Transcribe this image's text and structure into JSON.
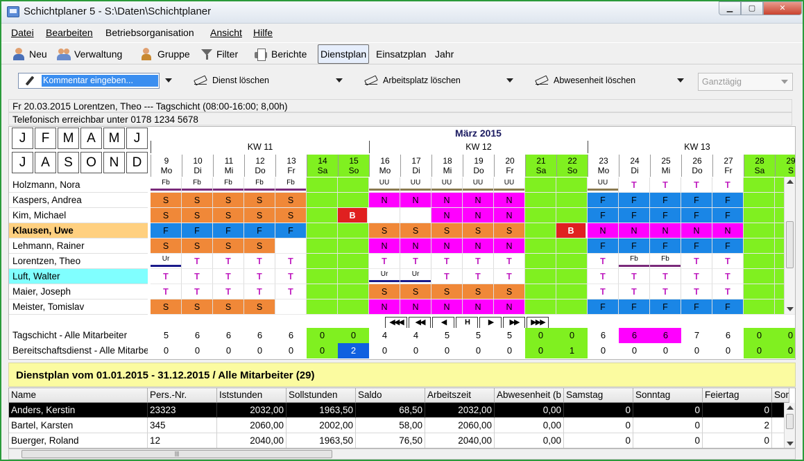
{
  "window": {
    "title": "Schichtplaner 5 - S:\\Daten\\Schichtplaner"
  },
  "menu": [
    "Datei",
    "Bearbeiten",
    "Betriebsorganisation",
    "Ansicht",
    "Hilfe"
  ],
  "toolbar": {
    "neu": "Neu",
    "verwaltung": "Verwaltung",
    "gruppe": "Gruppe",
    "filter": "Filter",
    "berichte": "Berichte",
    "dienstplan": "Dienstplan",
    "einsatzplan": "Einsatzplan",
    "jahr": "Jahr"
  },
  "actions": {
    "comment": "Kommentar eingeben...",
    "dienst": "Dienst löschen",
    "arbeitsplatz": "Arbeitsplatz löschen",
    "abwesenheit": "Abwesenheit löschen",
    "ganztaegig": "Ganztägig"
  },
  "info": {
    "line1": "Fr 20.03.2015 Lorentzen, Theo --- Tagschicht (08:00-16:00; 8,00h)",
    "line2": "Telefonisch erreichbar unter 0178 1234 5678"
  },
  "months": [
    [
      "J",
      "F",
      "M",
      "A",
      "M",
      "J"
    ],
    [
      "J",
      "A",
      "S",
      "O",
      "N",
      "D"
    ]
  ],
  "calendar": {
    "month": "März 2015",
    "weeks": [
      {
        "label": "KW 11"
      },
      {
        "label": "KW 12"
      },
      {
        "label": "KW 13"
      }
    ],
    "days": [
      {
        "d": "9",
        "w": "Mo",
        "we": false
      },
      {
        "d": "10",
        "w": "Di",
        "we": false
      },
      {
        "d": "11",
        "w": "Mi",
        "we": false
      },
      {
        "d": "12",
        "w": "Do",
        "we": false
      },
      {
        "d": "13",
        "w": "Fr",
        "we": false
      },
      {
        "d": "14",
        "w": "Sa",
        "we": true
      },
      {
        "d": "15",
        "w": "So",
        "we": true
      },
      {
        "d": "16",
        "w": "Mo",
        "we": false
      },
      {
        "d": "17",
        "w": "Di",
        "we": false
      },
      {
        "d": "18",
        "w": "Mi",
        "we": false
      },
      {
        "d": "19",
        "w": "Do",
        "we": false
      },
      {
        "d": "20",
        "w": "Fr",
        "we": false
      },
      {
        "d": "21",
        "w": "Sa",
        "we": true
      },
      {
        "d": "22",
        "w": "So",
        "we": true
      },
      {
        "d": "23",
        "w": "Mo",
        "we": false
      },
      {
        "d": "24",
        "w": "Di",
        "we": false
      },
      {
        "d": "25",
        "w": "Mi",
        "we": false
      },
      {
        "d": "26",
        "w": "Do",
        "we": false
      },
      {
        "d": "27",
        "w": "Fr",
        "we": false
      },
      {
        "d": "28",
        "w": "Sa",
        "we": true
      },
      {
        "d": "29",
        "w": "S",
        "we": true
      }
    ]
  },
  "colors": {
    "S": "#f08838",
    "N": "#ff00ff",
    "F": "#1a86e6",
    "B": "#e02020",
    "weekend": "#80f020",
    "T": "#ffffff",
    "Fb_bar": "#7a2a7a",
    "UU_bar": "#8a7a50",
    "Ur_bar": "#1a1a8a"
  },
  "employees": [
    {
      "name": "Holzmann, Nora",
      "hl": "",
      "cells": [
        "Fb",
        "Fb",
        "Fb",
        "Fb",
        "Fb",
        "",
        "",
        "UU",
        "UU",
        "UU",
        "UU",
        "UU",
        "",
        "",
        "UU",
        "T",
        "T",
        "T",
        "T",
        "",
        ""
      ]
    },
    {
      "name": "Kaspers, Andrea",
      "hl": "",
      "cells": [
        "S",
        "S",
        "S",
        "S",
        "S",
        "",
        "",
        "N",
        "N",
        "N",
        "N",
        "N",
        "",
        "",
        "F",
        "F",
        "F",
        "F",
        "F",
        "",
        ""
      ]
    },
    {
      "name": "Kim, Michael",
      "hl": "",
      "cells": [
        "S",
        "S",
        "S",
        "S",
        "S",
        "",
        "B",
        "",
        "",
        "N",
        "N",
        "N",
        "",
        "",
        "F",
        "F",
        "F",
        "F",
        "F",
        "",
        ""
      ]
    },
    {
      "name": "Klausen, Uwe",
      "hl": "#ffd080",
      "bold": true,
      "cells": [
        "F",
        "F",
        "F",
        "F",
        "F",
        "",
        "",
        "S",
        "S",
        "S",
        "S",
        "S",
        "",
        "B",
        "N",
        "N",
        "N",
        "N",
        "N",
        "",
        ""
      ]
    },
    {
      "name": "Lehmann, Rainer",
      "hl": "",
      "cells": [
        "S",
        "S",
        "S",
        "S",
        "",
        "",
        "",
        "N",
        "N",
        "N",
        "N",
        "N",
        "",
        "",
        "F",
        "F",
        "F",
        "F",
        "F",
        "",
        ""
      ]
    },
    {
      "name": "Lorentzen, Theo",
      "hl": "",
      "cells": [
        "Ur",
        "T",
        "T",
        "T",
        "T",
        "",
        "",
        "T",
        "T",
        "T",
        "T",
        "T",
        "",
        "",
        "T",
        "Fb",
        "Fb",
        "T",
        "T",
        "",
        ""
      ]
    },
    {
      "name": "Luft, Walter",
      "hl": "#80ffff",
      "cells": [
        "T",
        "T",
        "T",
        "T",
        "T",
        "",
        "",
        "Ur",
        "Ur",
        "T",
        "T",
        "T",
        "",
        "",
        "T",
        "T",
        "T",
        "T",
        "T",
        "",
        ""
      ]
    },
    {
      "name": "Maier, Joseph",
      "hl": "",
      "cells": [
        "T",
        "T",
        "T",
        "T",
        "T",
        "",
        "",
        "S",
        "S",
        "S",
        "S",
        "S",
        "",
        "",
        "T",
        "T",
        "T",
        "T",
        "T",
        "",
        ""
      ]
    },
    {
      "name": "Meister, Tomislav",
      "hl": "",
      "cells": [
        "S",
        "S",
        "S",
        "S",
        "",
        "",
        "",
        "N",
        "N",
        "N",
        "N",
        "N",
        "",
        "",
        "F",
        "F",
        "F",
        "F",
        "F",
        "",
        ""
      ]
    }
  ],
  "nav": [
    "◀◀◀",
    "◀◀",
    "◀",
    "H",
    "▶",
    "▶▶",
    "▶▶▶"
  ],
  "summary": [
    {
      "name": "Tagschicht - Alle Mitarbeiter",
      "vals": [
        "5",
        "6",
        "6",
        "6",
        "6",
        "0",
        "0",
        "4",
        "4",
        "5",
        "5",
        "5",
        "0",
        "0",
        "6",
        "6",
        "6",
        "7",
        "6",
        "0",
        "0"
      ],
      "hi": {
        "15": "#ff00ff",
        "16": "#ff00ff"
      }
    },
    {
      "name": "Bereitschaftsdienst - Alle Mitarbeiter",
      "vals": [
        "0",
        "0",
        "0",
        "0",
        "0",
        "0",
        "2",
        "0",
        "0",
        "0",
        "0",
        "0",
        "0",
        "1",
        "0",
        "0",
        "0",
        "0",
        "0",
        "0",
        "0"
      ],
      "hi": {
        "6": "#1060e0"
      }
    }
  ],
  "plan": {
    "title": "Dienstplan vom 01.01.2015 - 31.12.2015 / Alle Mitarbeiter (29)",
    "columns": [
      "Name",
      "Pers.-Nr.",
      "Iststunden",
      "Sollstunden",
      "Saldo",
      "Arbeitszeit",
      "Abwesenheit (b",
      "Samstag",
      "Sonntag",
      "Feiertag",
      "Son"
    ],
    "rows": [
      [
        "Anders, Kerstin",
        "23323",
        "2032,00",
        "1963,50",
        "68,50",
        "2032,00",
        "0,00",
        "0",
        "0",
        "0",
        ""
      ],
      [
        "Bartel, Karsten",
        "345",
        "2060,00",
        "2002,00",
        "58,00",
        "2060,00",
        "0,00",
        "0",
        "0",
        "2",
        ""
      ],
      [
        "Buerger, Roland",
        "12",
        "2040,00",
        "1963,50",
        "76,50",
        "2040,00",
        "0,00",
        "0",
        "0",
        "0",
        ""
      ]
    ]
  }
}
